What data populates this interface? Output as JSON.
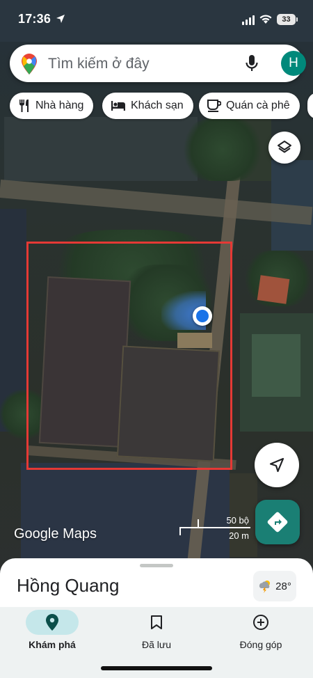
{
  "status_bar": {
    "time": "17:36",
    "battery": "33"
  },
  "search": {
    "placeholder": "Tìm kiếm ở đây",
    "avatar_letter": "H"
  },
  "chips": [
    {
      "label": "Nhà hàng",
      "icon": "restaurant-icon"
    },
    {
      "label": "Khách sạn",
      "icon": "hotel-icon"
    },
    {
      "label": "Quán cà phê",
      "icon": "coffee-icon"
    }
  ],
  "map": {
    "logo_google": "Google",
    "logo_maps": "Maps",
    "scale_imperial": "50 bộ",
    "scale_metric": "20 m",
    "selection_color": "#e53935",
    "location_color": "#1a73e8"
  },
  "sheet": {
    "place_name": "Hồng Quang",
    "weather_temp": "28°",
    "weather_icon": "thunderstorm-icon"
  },
  "bottom_nav": [
    {
      "label": "Khám phá",
      "icon": "explore-pin-icon",
      "active": true
    },
    {
      "label": "Đã lưu",
      "icon": "bookmark-icon",
      "active": false
    },
    {
      "label": "Đóng góp",
      "icon": "add-circle-icon",
      "active": false
    }
  ],
  "colors": {
    "accent": "#1a7f74",
    "nav_active": "#c5e7ea"
  }
}
